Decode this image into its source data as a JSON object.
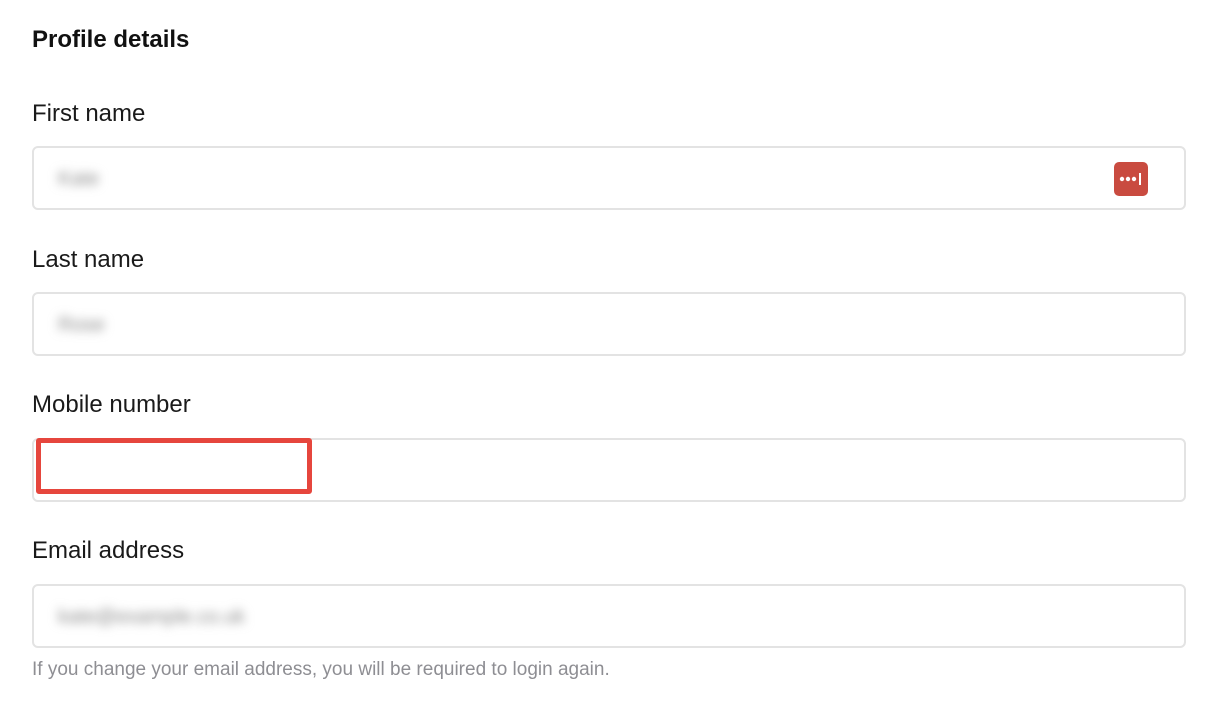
{
  "section": {
    "title": "Profile details"
  },
  "fields": {
    "first_name": {
      "label": "First name",
      "value": "Kate"
    },
    "last_name": {
      "label": "Last name",
      "value": "Rose"
    },
    "mobile": {
      "label": "Mobile number",
      "value": ""
    },
    "email": {
      "label": "Email address",
      "value": "kate@example.co.uk",
      "help": "If you change your email address, you will be required to login again."
    }
  },
  "icons": {
    "password_manager": "password-manager-icon"
  },
  "colors": {
    "password_manager_bg": "#c94b40",
    "redaction_border": "#e6463d",
    "input_border": "#e3e3e3",
    "help_text": "#8e8e93"
  }
}
